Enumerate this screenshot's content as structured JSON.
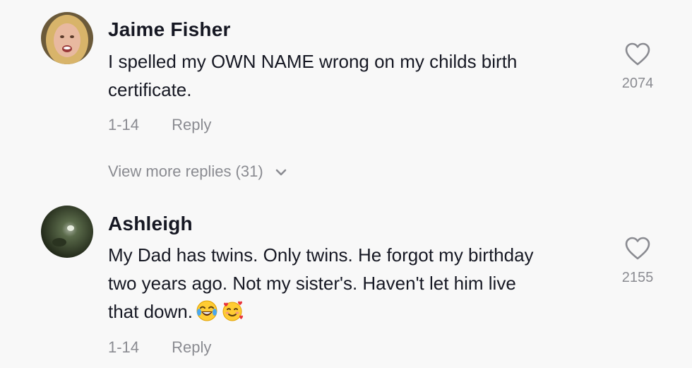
{
  "comments": [
    {
      "username": "Jaime Fisher",
      "text_lines": [
        "I spelled my OWN NAME wrong on my childs birth",
        "certificate."
      ],
      "date": "1-14",
      "reply_label": "Reply",
      "like_count": "2074",
      "like_icon": "heart-outline-icon"
    },
    {
      "username": "Ashleigh",
      "text_lines": [
        "My Dad has twins. Only twins. He forgot my birthday",
        "two years ago. Not my sister's. Haven't let him live",
        "that down."
      ],
      "emojis": [
        "laughing-tears-emoji",
        "smiling-hearts-emoji"
      ],
      "date": "1-14",
      "reply_label": "Reply",
      "like_count": "2155",
      "like_icon": "heart-outline-icon"
    }
  ],
  "view_more_replies": {
    "label": "View more replies (31)",
    "icon": "chevron-down-icon"
  },
  "colors": {
    "background": "#f8f8f8",
    "text_primary": "#161823",
    "text_secondary": "#8a8b91"
  }
}
